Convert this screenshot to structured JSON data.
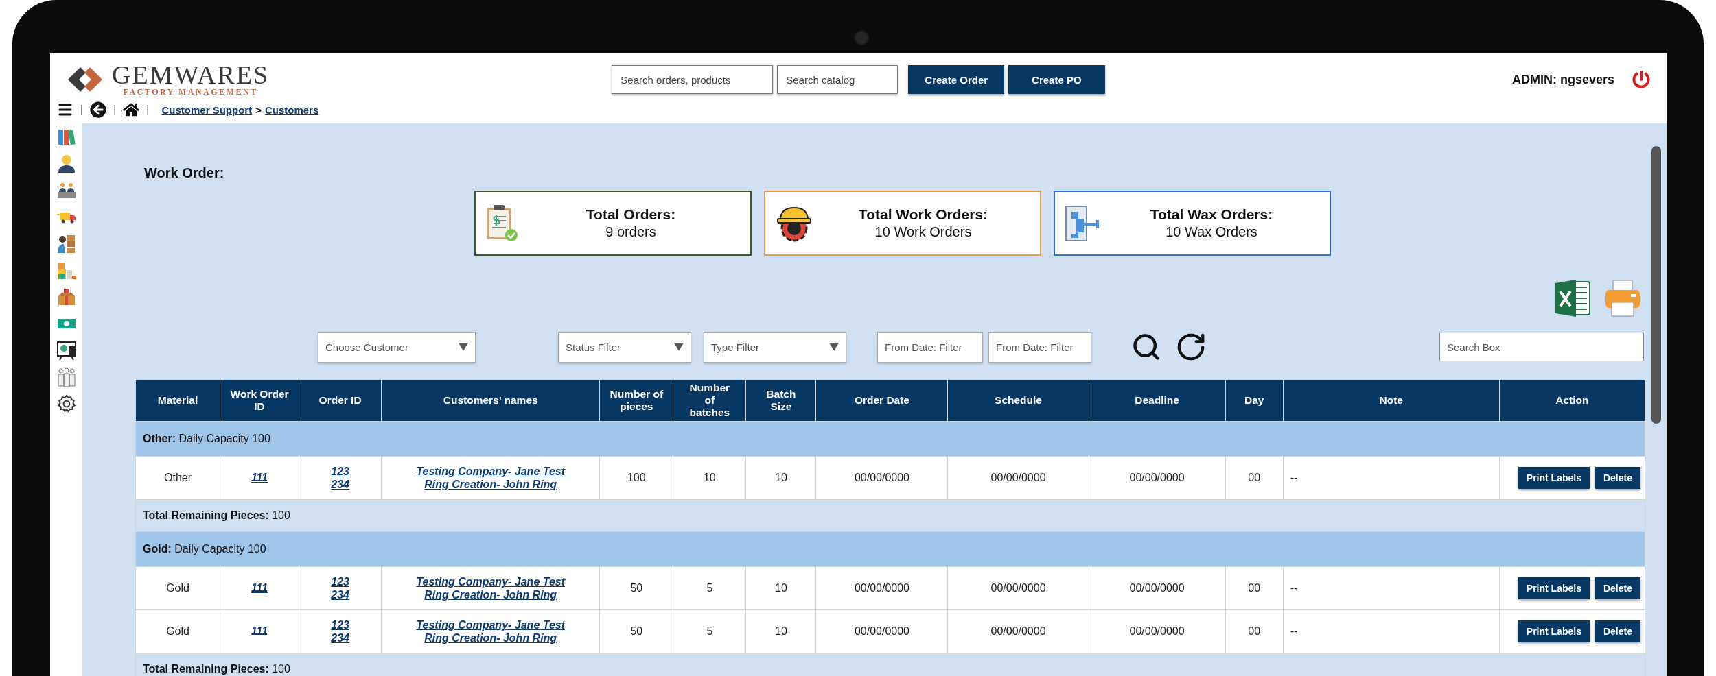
{
  "header": {
    "logo": {
      "name": "GEMWARES",
      "tagline": "FACTORY MANAGEMENT"
    },
    "search_fields": [
      {
        "placeholder": "Search orders, products"
      },
      {
        "placeholder": "Search catalog"
      }
    ],
    "buttons": [
      "Create Order",
      "Create PO"
    ],
    "user": "ADMIN: ngsevers"
  },
  "nav": {
    "separator": "|",
    "breadcrumb": [
      "Customer Support",
      "Customers"
    ],
    "breadcrumb_separator": ">"
  },
  "page_title": "Work Order:",
  "summary_cards": [
    {
      "kind": "orders",
      "title": "Total Orders:",
      "value": "9 orders",
      "color": "#3e5a2f"
    },
    {
      "kind": "work",
      "title": "Total Work Orders:",
      "value": "10 Work Orders",
      "color": "#e39b4f"
    },
    {
      "kind": "wax",
      "title": "Total Wax Orders:",
      "value": "10 Wax Orders",
      "color": "#2f6fd6"
    }
  ],
  "filters": [
    {
      "kind": "select",
      "placeholder": "Choose Customer"
    },
    {
      "kind": "select",
      "placeholder": "Status Filter"
    },
    {
      "kind": "select",
      "placeholder": "Type Filter"
    },
    {
      "kind": "date",
      "placeholder": "From Date: Filter"
    },
    {
      "kind": "date",
      "placeholder": "From Date: Filter"
    }
  ],
  "search_box": {
    "placeholder": "Search Box"
  },
  "table": {
    "columns": [
      "Material",
      "Work Order ID",
      "Order ID",
      "Customers’ names",
      "Number of pieces",
      "Number of batches",
      "Batch Size",
      "Order Date",
      "Schedule",
      "Deadline",
      "Day",
      "Note",
      "Action"
    ],
    "groups": [
      {
        "heading": "**Other:** Daily Capacity 100",
        "total": "**Total Remaining Pieces:** 100",
        "rows": [
          {
            "material": "Other",
            "work_order_id": "111",
            "order_ids": [
              "123",
              "234"
            ],
            "customers": [
              "Testing Company- Jane Test",
              "Ring Creation- John Ring"
            ],
            "pieces": "100",
            "batches": "10",
            "batch_size": "10",
            "order_date": "00/00/0000",
            "schedule": "00/00/0000",
            "deadline": "00/00/0000",
            "day": "00",
            "note": "--",
            "actions": [
              "Print Labels",
              "Delete"
            ]
          }
        ]
      },
      {
        "heading": "**Gold:** Daily Capacity 100",
        "total": "**Total Remaining Pieces:** 100",
        "rows": [
          {
            "material": "Gold",
            "work_order_id": "111",
            "order_ids": [
              "123",
              "234"
            ],
            "customers": [
              "Testing Company- Jane Test",
              "Ring Creation- John Ring"
            ],
            "pieces": "50",
            "batches": "5",
            "batch_size": "10",
            "order_date": "00/00/0000",
            "schedule": "00/00/0000",
            "deadline": "00/00/0000",
            "day": "00",
            "note": "--",
            "actions": [
              "Print Labels",
              "Delete"
            ]
          },
          {
            "material": "Gold",
            "work_order_id": "111",
            "order_ids": [
              "123",
              "234"
            ],
            "customers": [
              "Testing Company- Jane Test",
              "Ring Creation- John Ring"
            ],
            "pieces": "50",
            "batches": "5",
            "batch_size": "10",
            "order_date": "00/00/0000",
            "schedule": "00/00/0000",
            "deadline": "00/00/0000",
            "day": "00",
            "note": "--",
            "actions": [
              "Print Labels",
              "Delete"
            ]
          }
        ]
      }
    ]
  }
}
